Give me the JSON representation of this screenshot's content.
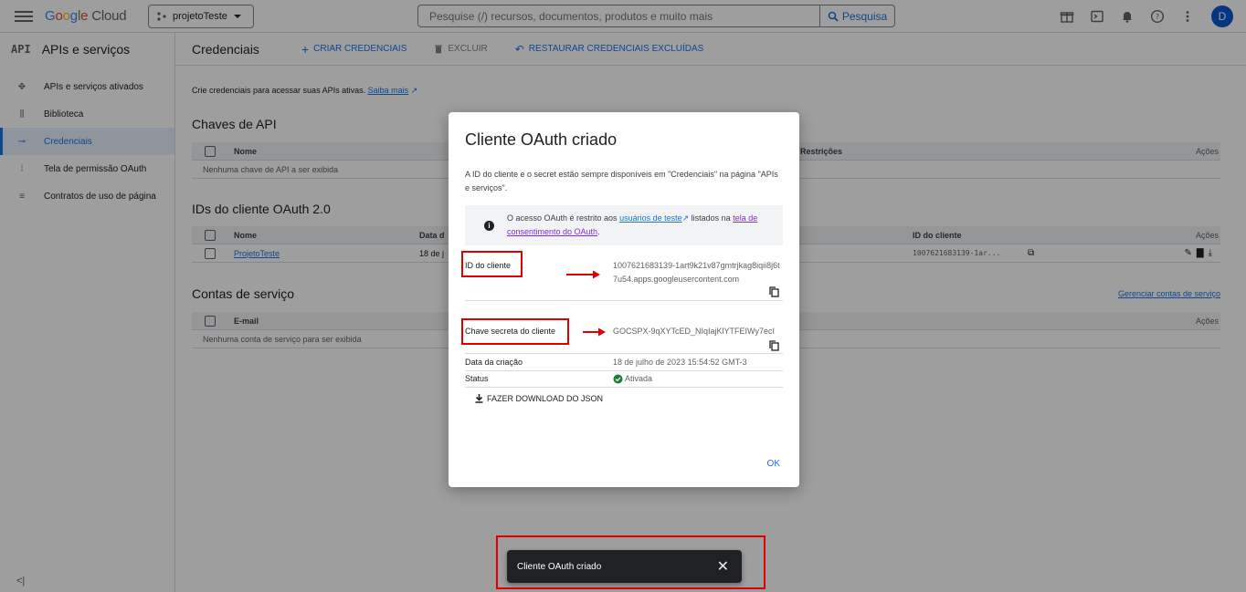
{
  "topbar": {
    "logo_parts": [
      "G",
      "o",
      "o",
      "g",
      "l",
      "e"
    ],
    "logo_cloud": "Cloud",
    "project": "projetoTeste",
    "search_placeholder": "Pesquise (/) recursos, documentos, produtos e muito mais",
    "search_button": "Pesquisa",
    "avatar_letter": "D"
  },
  "sidebar": {
    "icon_text": "API",
    "title": "APIs e serviços",
    "items": [
      {
        "label": "APIs e serviços ativados"
      },
      {
        "label": "Biblioteca"
      },
      {
        "label": "Credenciais"
      },
      {
        "label": "Tela de permissão OAuth"
      },
      {
        "label": "Contratos de uso de página"
      }
    ],
    "collapse": "<|"
  },
  "main": {
    "title": "Credenciais",
    "create_label": "CRIAR CREDENCIAIS",
    "delete_label": "EXCLUIR",
    "restore_label": "RESTAURAR CREDENCIAIS EXCLUÍDAS",
    "intro_text": "Crie credenciais para acessar suas APIs ativas.",
    "intro_link": "Saiba mais",
    "api_keys": {
      "title": "Chaves de API",
      "col_name": "Nome",
      "col_restrictions": "Restrições",
      "col_actions": "Ações",
      "empty": "Nenhuma chave de API a ser exibida"
    },
    "oauth": {
      "title": "IDs do cliente OAuth 2.0",
      "col_name": "Nome",
      "col_date": "Data d",
      "col_client_id": "ID do cliente",
      "col_actions": "Ações",
      "row_name": "ProjetoTeste",
      "row_date": "18 de j",
      "row_client_id": "1007621683139-1ar..."
    },
    "service": {
      "title": "Contas de serviço",
      "manage_link": "Gerenciar contas de serviço",
      "col_email": "E-mail",
      "col_actions": "Ações",
      "empty": "Nenhuma conta de serviço para ser exibida"
    }
  },
  "dialog": {
    "title": "Cliente OAuth criado",
    "description": "A ID do cliente e o secret estão sempre disponíveis em \"Credenciais\" na página \"APIs e serviços\".",
    "notice_prefix": "O acesso OAuth é restrito aos ",
    "notice_link1": "usuários de teste",
    "notice_mid": " listados na ",
    "notice_link2": "tela de consentimento do OAuth",
    "notice_suffix": ".",
    "client_id_label": "ID do cliente",
    "client_id_value": "1007621683139-1art9k21v87gmtrjkag8iqii8j6t7u54.apps.googleusercontent.com",
    "secret_label": "Chave secreta do cliente",
    "secret_value": "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",
    "created_label": "Data da criação",
    "created_value": "18 de julho de 2023 15:54:52 GMT-3",
    "status_label": "Status",
    "status_value": "Ativada",
    "download_label": "FAZER DOWNLOAD DO JSON",
    "ok_label": "OK"
  },
  "snackbar": {
    "text": "Cliente OAuth criado"
  },
  "colors": {
    "accent": "#1a73e8",
    "annotation": "#e00000",
    "status_ok": "#188038"
  }
}
